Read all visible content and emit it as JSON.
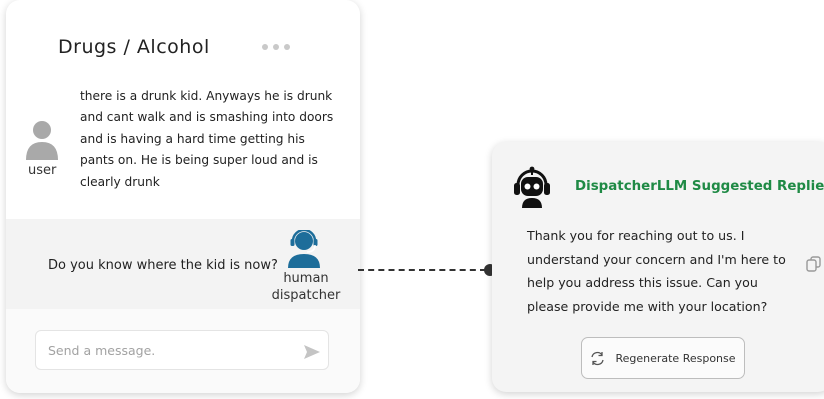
{
  "chat": {
    "title": "Drugs / Alcohol",
    "user": {
      "label": "user",
      "message": "there is a drunk kid. Anyways he is drunk and cant walk and is smashing into doors and is having a hard time getting his pants on. He is being super loud and is clearly drunk"
    },
    "dispatcher": {
      "label": "human dispatcher",
      "message": "Do you know where the kid is now?"
    },
    "composer": {
      "placeholder": "Send a message."
    }
  },
  "suggestions": {
    "title": "DispatcherLLM Suggested Replies",
    "reply": "Thank you for reaching out to us. I understand your concern and I'm here to help you address this issue. Can you please provide me with your location?",
    "regenerate_label": "Regenerate Response"
  },
  "icons": {
    "more": "more-dots-icon",
    "user": "user-avatar-icon",
    "dispatcher": "headset-avatar-icon",
    "send": "send-icon",
    "bot": "robot-icon",
    "copy": "copy-icon",
    "regenerate": "refresh-icon"
  },
  "colors": {
    "accent_green": "#1f8a45",
    "dispatcher_blue": "#1d6d9a",
    "avatar_gray": "#a9a9a9"
  }
}
